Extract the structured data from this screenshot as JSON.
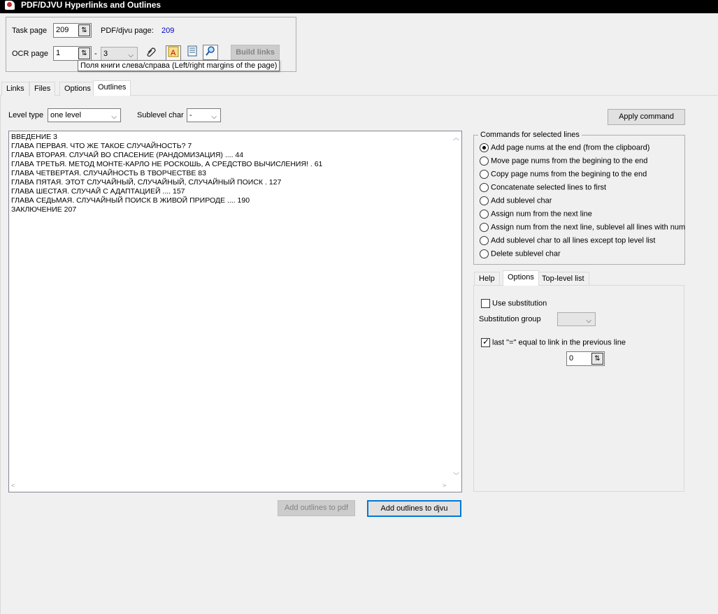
{
  "window": {
    "title": "PDF/DJVU Hyperlinks and Outlines"
  },
  "header": {
    "task_page_label": "Task page",
    "task_page_value": "209",
    "pdf_djvu_page_label": "PDF/djvu page:",
    "pdf_djvu_page_value": "209",
    "pdf_djvu_page_color": "#0000cc",
    "ocr_page_label": "OCR page",
    "ocr_page_value": "1",
    "ocr_dash": "-",
    "ocr_page_to": "3",
    "build_links_label": "Build links",
    "tooltip": "Поля книги слева/справа (Left/right margins of the page)",
    "icons": [
      "attach-icon",
      "text-frame-icon",
      "page-list-icon",
      "find-icon"
    ]
  },
  "tabs": [
    "Links",
    "Files",
    "Options",
    "Outlines"
  ],
  "active_tab": "Outlines",
  "outlines": {
    "level_type_label": "Level type",
    "level_type_value": "one level",
    "sublevel_char_label": "Sublevel char",
    "sublevel_char_value": "-",
    "apply_command_label": "Apply command",
    "lines": [
      "ВВЕДЕНИЕ 3",
      "ГЛАВА ПЕРВАЯ. ЧТО ЖЕ ТАКОЕ СЛУЧАЙНОСТЬ? 7",
      "ГЛАВА ВТОРАЯ. СЛУЧАЙ ВО СПАСЕНИЕ (РАНДОМИЗАЦИЯ) .... 44",
      "ГЛАВА ТРЕТЬЯ. МЕТОД МОНТЕ-КАРЛО НЕ РОСКОШЬ, А СРЕДСТВО ВЫЧИСЛЕНИЯ! . 61",
      "ГЛАВА ЧЕТВЕРТАЯ. СЛУЧАЙНОСТЬ В ТВОРЧЕСТВЕ 83",
      "ГЛАВА ПЯТАЯ. ЭТОТ СЛУЧАЙНЫЙ, СЛУЧАЙНЫЙ, СЛУЧАЙНЫЙ ПОИСК . 127",
      "ГЛАВА ШЕСТАЯ. СЛУЧАЙ С АДАПТАЦИЕЙ .... 157",
      "ГЛАВА СЕДЬМАЯ. СЛУЧАЙНЫЙ ПОИСК В ЖИВОЙ ПРИРОДЕ .... 190",
      "ЗАКЛЮЧЕНИЕ 207"
    ],
    "add_to_pdf_label": "Add outlines to pdf",
    "add_to_djvu_label": "Add outlines to djvu"
  },
  "commands": {
    "group_label": "Commands for selected lines",
    "options": [
      "Add page nums at the end (from the clipboard)",
      "Move page nums from the begining to the end",
      "Copy page nums from the begining to the end",
      "Concatenate selected lines to first",
      "Add sublevel char",
      "Assign num from the next line",
      "Assign num from the next line, sublevel all lines with num",
      "Add sublevel char to all lines except top level list",
      "Delete sublevel char"
    ],
    "selected_index": 0
  },
  "sub_tabs": [
    "Help",
    "Options",
    "Top-level list"
  ],
  "active_sub_tab": "Options",
  "sub_options": {
    "use_substitution_label": "Use substitution",
    "use_substitution_checked": false,
    "substitution_group_label": "Substitution group",
    "substitution_group_value": "",
    "last_equal_label": "last \"=\" equal to link in the previous line",
    "last_equal_checked": true,
    "offset_value": "0"
  }
}
